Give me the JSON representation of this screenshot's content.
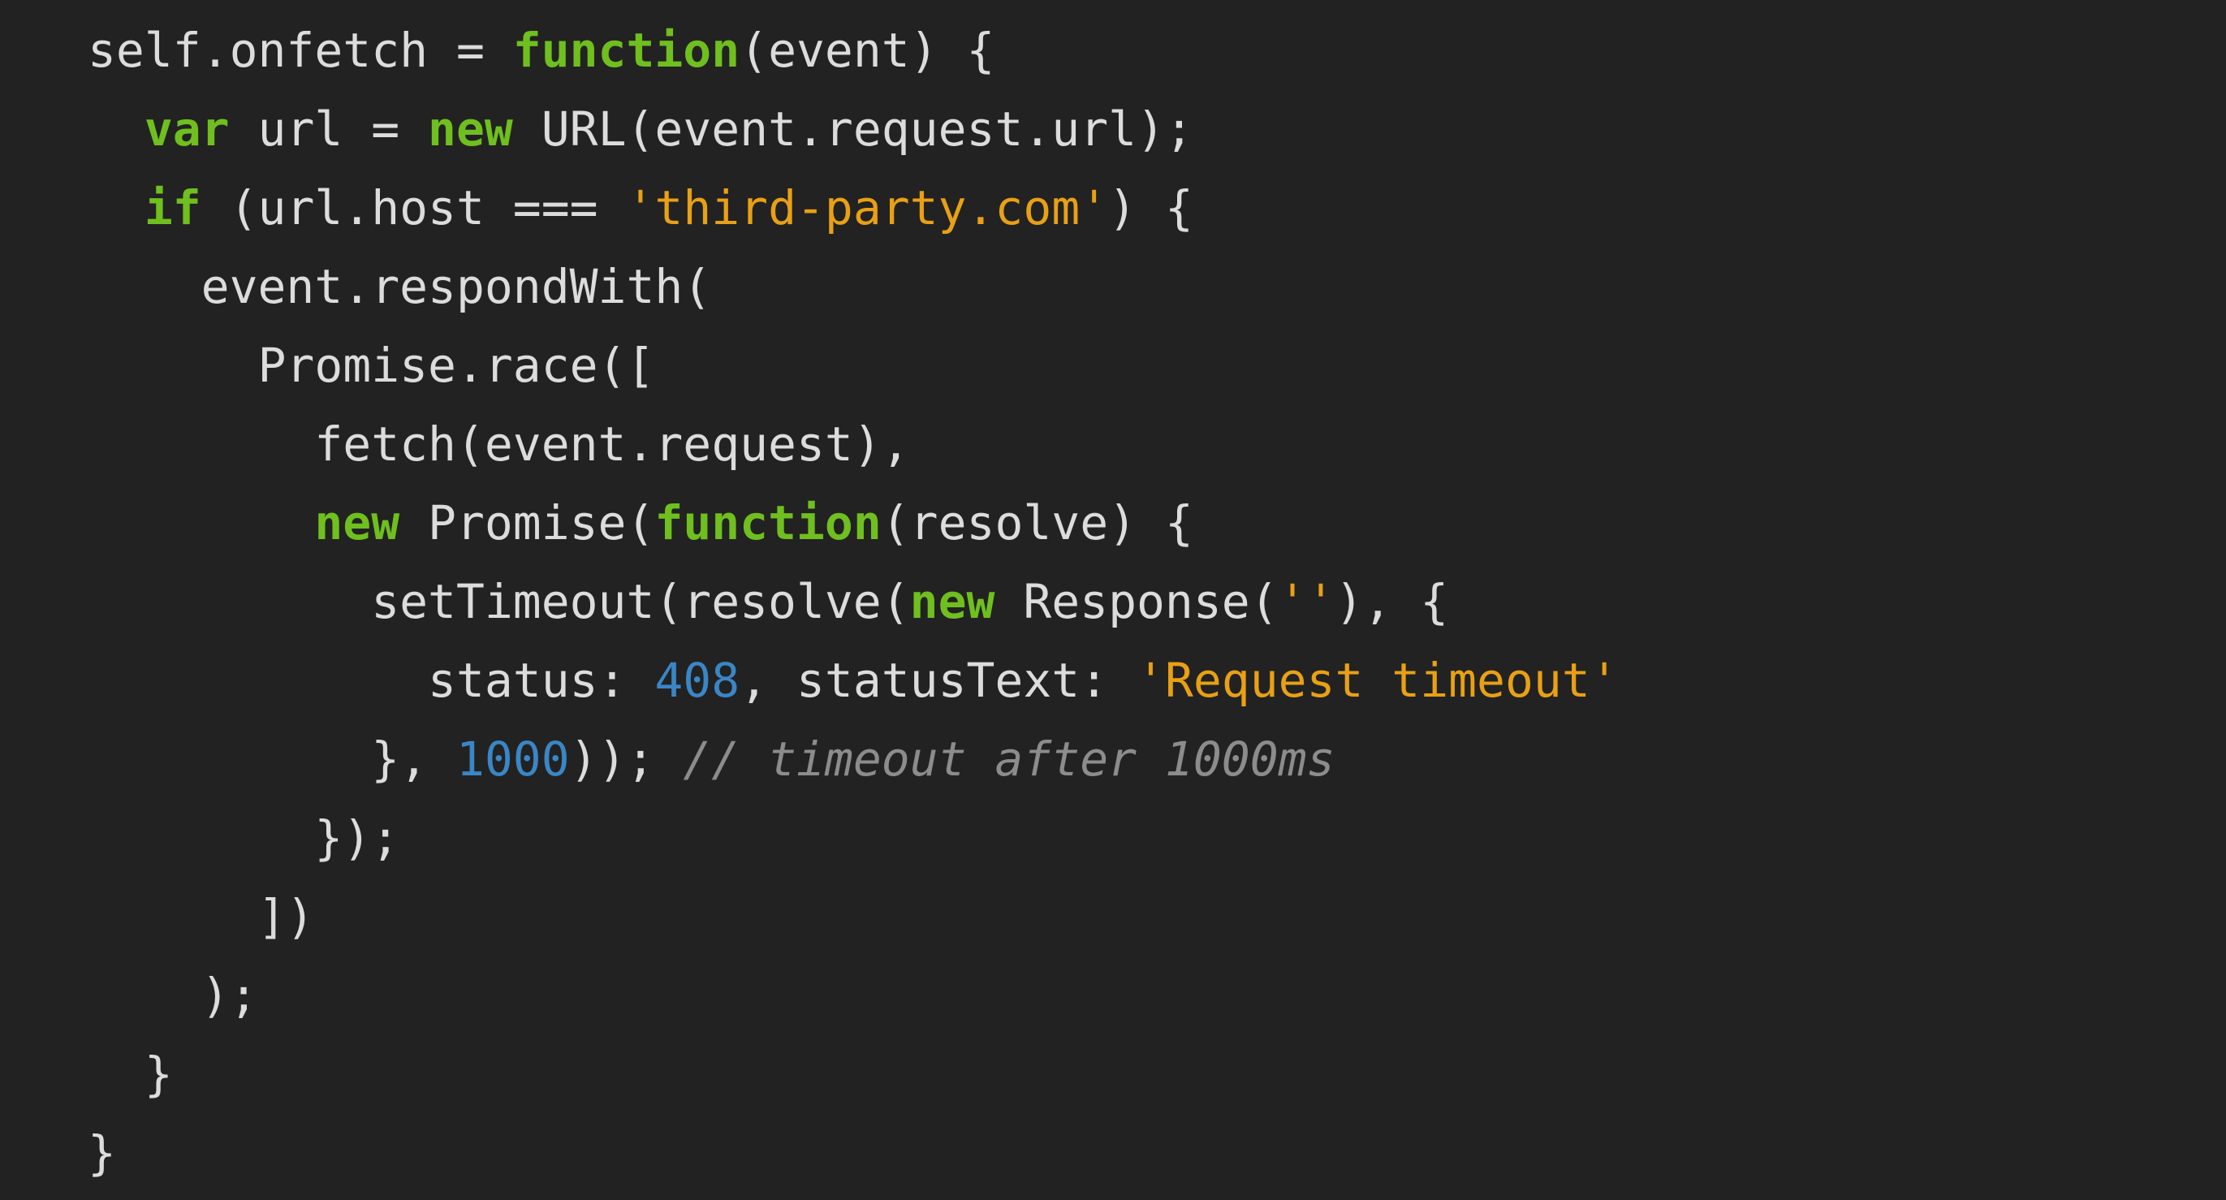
{
  "editor": {
    "language": "javascript",
    "colors": {
      "background": "#222222",
      "text": "#dcdcdc",
      "keyword": "#6fbf1f",
      "string": "#e8a015",
      "number": "#3a86c6",
      "comment": "#8c8c8c"
    },
    "lines": [
      [
        {
          "t": "txt",
          "v": "self.onfetch = "
        },
        {
          "t": "kw",
          "v": "function"
        },
        {
          "t": "txt",
          "v": "(event) {"
        }
      ],
      [
        {
          "t": "txt",
          "v": "  "
        },
        {
          "t": "kw",
          "v": "var"
        },
        {
          "t": "txt",
          "v": " url = "
        },
        {
          "t": "kw",
          "v": "new"
        },
        {
          "t": "txt",
          "v": " URL(event.request.url);"
        }
      ],
      [
        {
          "t": "txt",
          "v": "  "
        },
        {
          "t": "kw",
          "v": "if"
        },
        {
          "t": "txt",
          "v": " (url.host === "
        },
        {
          "t": "str",
          "v": "'third-party.com'"
        },
        {
          "t": "txt",
          "v": ") {"
        }
      ],
      [
        {
          "t": "txt",
          "v": "    event.respondWith("
        }
      ],
      [
        {
          "t": "txt",
          "v": "      Promise.race(["
        }
      ],
      [
        {
          "t": "txt",
          "v": "        fetch(event.request),"
        }
      ],
      [
        {
          "t": "txt",
          "v": "        "
        },
        {
          "t": "kw",
          "v": "new"
        },
        {
          "t": "txt",
          "v": " Promise("
        },
        {
          "t": "kw",
          "v": "function"
        },
        {
          "t": "txt",
          "v": "(resolve) {"
        }
      ],
      [
        {
          "t": "txt",
          "v": "          setTimeout(resolve("
        },
        {
          "t": "kw",
          "v": "new"
        },
        {
          "t": "txt",
          "v": " Response("
        },
        {
          "t": "str",
          "v": "''"
        },
        {
          "t": "txt",
          "v": "), {"
        }
      ],
      [
        {
          "t": "txt",
          "v": "            status: "
        },
        {
          "t": "num",
          "v": "408"
        },
        {
          "t": "txt",
          "v": ", statusText: "
        },
        {
          "t": "str",
          "v": "'Request timeout'"
        }
      ],
      [
        {
          "t": "txt",
          "v": "          }, "
        },
        {
          "t": "num",
          "v": "1000"
        },
        {
          "t": "txt",
          "v": ")); "
        },
        {
          "t": "com",
          "v": "// timeout after 1000ms"
        }
      ],
      [
        {
          "t": "txt",
          "v": "        });"
        }
      ],
      [
        {
          "t": "txt",
          "v": "      ])"
        }
      ],
      [
        {
          "t": "txt",
          "v": "    );"
        }
      ],
      [
        {
          "t": "txt",
          "v": "  }"
        }
      ],
      [
        {
          "t": "txt",
          "v": "}"
        }
      ]
    ]
  }
}
